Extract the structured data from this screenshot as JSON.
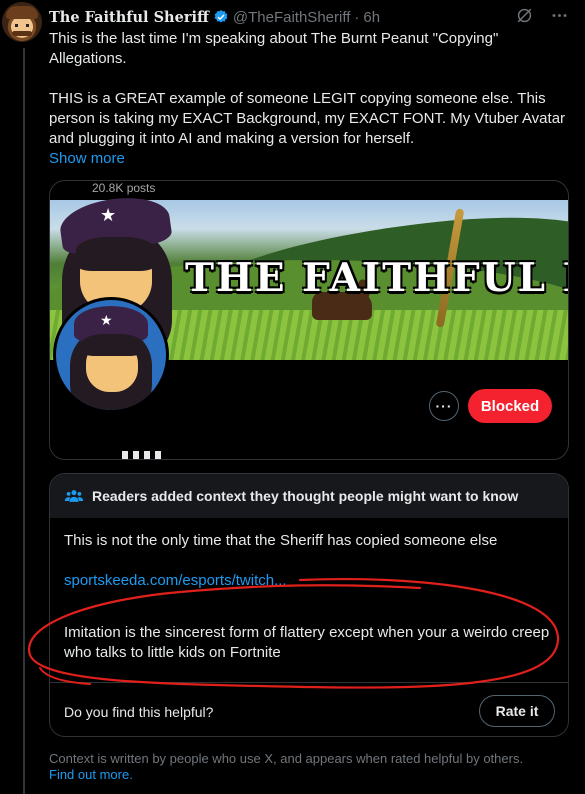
{
  "tweet": {
    "display_name": "The Faithful Sheriff",
    "handle": "@TheFaithSheriff",
    "separator": "·",
    "time": "6h",
    "text_line1": "This is the last time I'm speaking about The Burnt Peanut \"Copying\" Allegations.",
    "text_line2": "THIS is a GREAT example of someone LEGIT copying someone else. This person is taking my EXACT Background, my EXACT FONT. My Vtuber Avatar and plugging it into AI and making a version for herself.",
    "show_more": "Show more"
  },
  "media": {
    "posts_count": "20.8K posts",
    "banner_title": "THE FAITHFUL EMI",
    "more_label": "···",
    "blocked_label": "Blocked"
  },
  "community_note": {
    "header": "Readers added context they thought people might want to know",
    "line1": "This is not the only time that the Sheriff has copied someone else",
    "link": "sportskeeda.com/esports/twitch...",
    "line3": "Imitation is the sincerest form of flattery except when your a weirdo creep who talks to little kids on Fortnite",
    "helpful_question": "Do you find this helpful?",
    "rate_button": "Rate it"
  },
  "footer": {
    "text": "Context is written by people who use X, and appears when rated helpful by others.",
    "link": "Find out more."
  },
  "colors": {
    "background": "#000000",
    "text": "#e7e9ea",
    "muted": "#71767b",
    "link": "#1d9bf0",
    "blocked": "#f4212e",
    "annotation": "#e0201a"
  },
  "icons": [
    "verified-badge-icon",
    "grok-icon",
    "more-options-icon",
    "community-people-icon"
  ]
}
